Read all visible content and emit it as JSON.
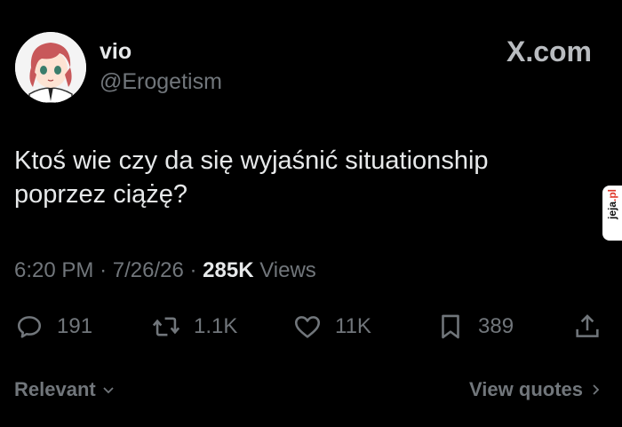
{
  "author": {
    "display_name": "vio",
    "handle": "@Erogetism"
  },
  "brand": "X.com",
  "tweet": {
    "text_line1": "Ktoś wie czy da się wyjaśnić situationship",
    "text_line2": "poprzez ciążę?"
  },
  "meta": {
    "time": "6:20 PM",
    "separator": "·",
    "date": "7/26/26",
    "views_count": "285K",
    "views_label": "Views"
  },
  "actions": {
    "replies": "191",
    "reposts": "1.1K",
    "likes": "11K",
    "bookmarks": "389"
  },
  "footer": {
    "sort_label": "Relevant",
    "quotes_link": "View quotes"
  },
  "watermark": {
    "text": "jeja",
    "suffix": ".pl"
  },
  "colors": {
    "background": "#000000",
    "text_primary": "#e7e9ea",
    "text_secondary": "#71767b"
  },
  "icons": {
    "reply": "speech-bubble-icon",
    "repost": "repost-arrows-icon",
    "like": "heart-icon",
    "bookmark": "bookmark-icon",
    "share": "share-upload-icon"
  }
}
